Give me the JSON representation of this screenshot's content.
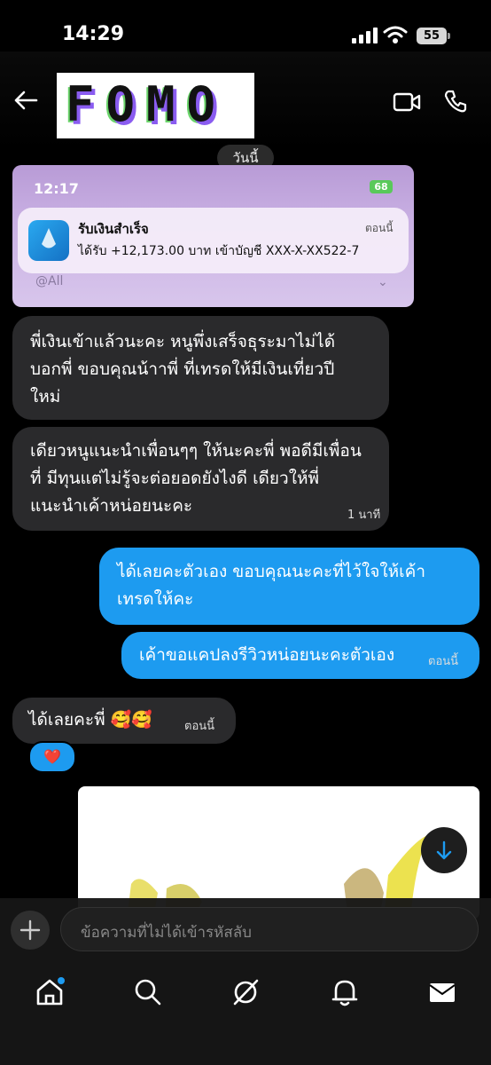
{
  "status_bar": {
    "time": "14:29",
    "battery": "55"
  },
  "header": {
    "title": "FOMO"
  },
  "date_separator": "วันนี้",
  "screenshot": {
    "time": "12:17",
    "battery": "68",
    "notification": {
      "title": "รับเงินสำเร็จ",
      "when": "ตอนนี้",
      "body": "ได้รับ +12,173.00 บาท เข้าบัญชี XXX-X-XX522-7"
    },
    "mention": "@All"
  },
  "messages": [
    {
      "side": "in",
      "lines": [
        "พี่เงินเข้าแล้วนะคะ หนูพึ่งเสร็จธุระมาไม่ได้",
        "บอกพี่ ขอบคุณน้าาพี่ ที่เทรดให้มีเงินเที่ยวปี",
        "ใหม่"
      ],
      "time": ""
    },
    {
      "side": "in",
      "lines": [
        "เดียวหนูแนะนำเพื่อนๆๆ ให้นะคะพี่ พอดีมีเพื่อน",
        "ที่ มีทุนแต่ไม่รู้จะต่อยอดยังไงดี เดียวให้พี่",
        "แนะนำเค้าหน่อยนะคะ"
      ],
      "time": "1 นาที"
    },
    {
      "side": "out",
      "lines": [
        "ได้เลยคะตัวเอง ขอบคุณนะคะที่ไว้ใจให้เค้า",
        "เทรดให้คะ"
      ],
      "time": ""
    },
    {
      "side": "out",
      "lines": [
        "เค้าขอแคปลงรีวิวหน่อยนะคะตัวเอง"
      ],
      "time": "ตอนนี้"
    },
    {
      "side": "in",
      "lines": [
        "ได้เลยคะพี่ 🥰🥰"
      ],
      "time": "ตอนนี้"
    }
  ],
  "reaction": "❤️",
  "composer": {
    "placeholder": "ข้อความที่ไม่ได้เข้ารหัสลับ"
  },
  "colors": {
    "accent": "#1d9bf0",
    "incoming_bubble": "#2a2a2c",
    "background": "#000000"
  }
}
